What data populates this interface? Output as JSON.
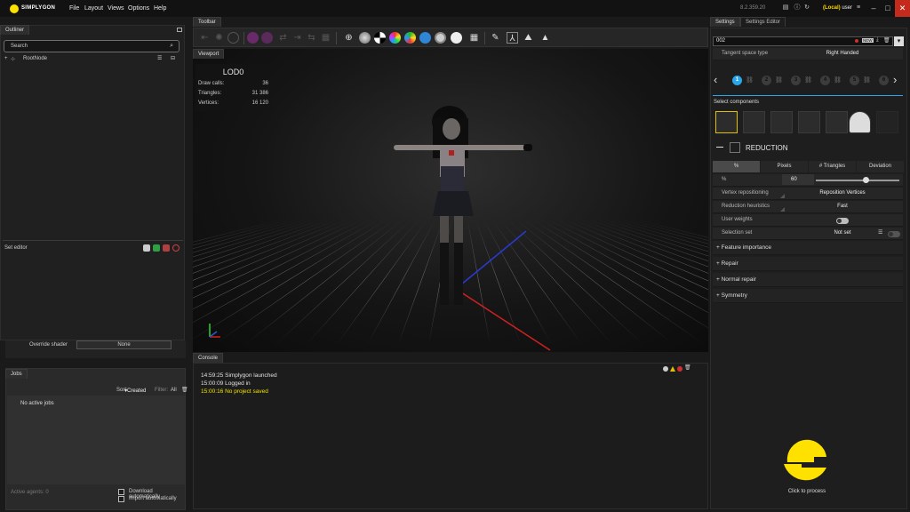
{
  "app": {
    "brand": "SIMPLYGON",
    "menu": [
      "File",
      "Layout",
      "Views",
      "Options",
      "Help"
    ],
    "version": "8.2.359.20",
    "user_location": "(Local)",
    "user_name": "user"
  },
  "outliner": {
    "tab": "Outliner",
    "search_placeholder": "Search",
    "root_node": "RootNode",
    "set_editor_label": "Set editor",
    "override_shader_label": "Override shader",
    "override_shader_value": "None"
  },
  "jobs": {
    "tab": "Jobs",
    "sort_label": "Sort:",
    "sort_value": "Created",
    "filter_label": "Filter:",
    "filter_value": "All",
    "empty": "No active jobs",
    "active_agents": "Active agents: 0",
    "download_auto": "Download automatically",
    "import_auto": "Import automatically"
  },
  "toolbar": {
    "tab": "Toolbar"
  },
  "viewport": {
    "tab": "Viewport",
    "lod_title": "LOD0",
    "stats": [
      {
        "label": "Draw calls:",
        "value": "36"
      },
      {
        "label": "Triangles:",
        "value": "31 386"
      },
      {
        "label": "Vertices:",
        "value": "16 120"
      }
    ]
  },
  "console": {
    "tab": "Console",
    "lines": [
      {
        "text": "14:59:25 Simplygon launched",
        "color": "#e0e0e0"
      },
      {
        "text": "15:00:09 Logged in",
        "color": "#e0e0e0"
      },
      {
        "text": "15:00:16 No project saved",
        "color": "#f0e000"
      }
    ]
  },
  "settings": {
    "tab_settings": "Settings",
    "tab_editor": "Settings Editor",
    "pipeline_name": "002",
    "new_badge": "NEW",
    "tangent_label": "Tangent space type",
    "tangent_value": "Right Handed",
    "steps": [
      "1",
      "2",
      "3",
      "4",
      "5",
      "6"
    ],
    "select_components": "Select components",
    "reduction_title": "REDUCTION",
    "mode_tabs": [
      "%",
      "Pixels",
      "# Triangles",
      "Deviation"
    ],
    "percent_label": "%",
    "percent_value": "60",
    "percent_slider": 0.6,
    "rows": [
      {
        "label": "Vertex repositioning",
        "value": "Reposition Vertices"
      },
      {
        "label": "Reduction heuristics",
        "value": "Fast"
      },
      {
        "label": "User weights",
        "value": ""
      },
      {
        "label": "Selection set",
        "value": "Not set"
      }
    ],
    "sections": [
      "Feature importance",
      "Repair",
      "Normal repair",
      "Symmetry"
    ],
    "process_label": "Click to process",
    "accent": "#ffe100"
  }
}
